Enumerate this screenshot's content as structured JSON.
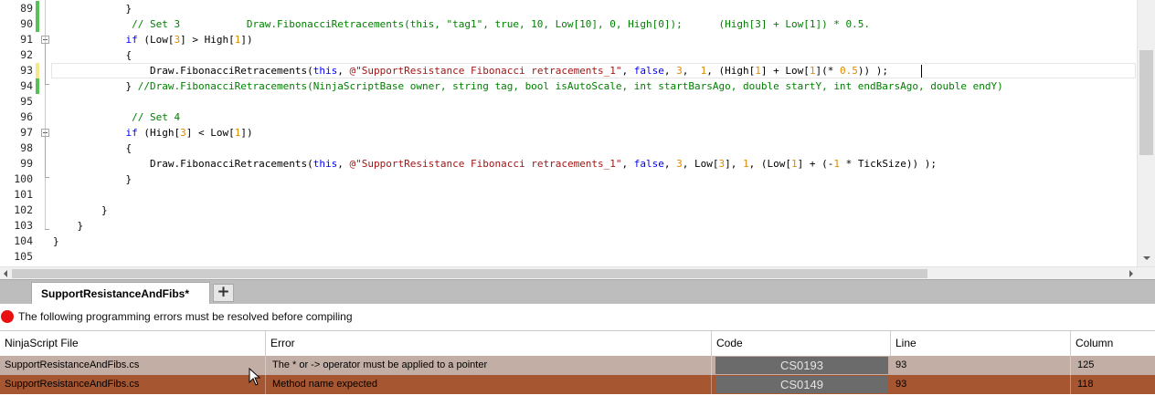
{
  "editor": {
    "lines": [
      {
        "num": "89",
        "code": "            }",
        "change": "saved",
        "fold": "none"
      },
      {
        "num": "90",
        "code": "             // Set 3           Draw.FibonacciRetracements(this, \"tag1\", true, 10, Low[10], 0, High[0]);      (High[3] + Low[1]) * 0.5.",
        "change": "saved",
        "fold": "none"
      },
      {
        "num": "91",
        "code": "            if (Low[3] > High[1])",
        "change": "none",
        "fold": "open"
      },
      {
        "num": "92",
        "code": "            {",
        "change": "none",
        "fold": "none"
      },
      {
        "num": "93",
        "code": "                Draw.FibonacciRetracements(this, @\"SupportResistance Fibonacci retracements_1\", false, 3,  1, (High[1] + Low[1](* 0.5)) );",
        "change": "unsaved",
        "fold": "none"
      },
      {
        "num": "94",
        "code": "            } //Draw.FibonacciRetracements(NinjaScriptBase owner, string tag, bool isAutoScale, int startBarsAgo, double startY, int endBarsAgo, double endY)",
        "change": "saved",
        "fold": "none"
      },
      {
        "num": "95",
        "code": "",
        "change": "none",
        "fold": "none"
      },
      {
        "num": "96",
        "code": "             // Set 4",
        "change": "none",
        "fold": "none"
      },
      {
        "num": "97",
        "code": "            if (High[3] < Low[1])",
        "change": "none",
        "fold": "open"
      },
      {
        "num": "98",
        "code": "            {",
        "change": "none",
        "fold": "none"
      },
      {
        "num": "99",
        "code": "                Draw.FibonacciRetracements(this, @\"SupportResistance Fibonacci retracements_1\", false, 3, Low[3], 1, (Low[1] + (-1 * TickSize)) );",
        "change": "none",
        "fold": "none"
      },
      {
        "num": "100",
        "code": "            }",
        "change": "none",
        "fold": "none"
      },
      {
        "num": "101",
        "code": "",
        "change": "none",
        "fold": "none"
      },
      {
        "num": "102",
        "code": "        }",
        "change": "none",
        "fold": "none"
      },
      {
        "num": "103",
        "code": "    }",
        "change": "none",
        "fold": "none"
      },
      {
        "num": "104",
        "code": "}",
        "change": "none",
        "fold": "none"
      },
      {
        "num": "105",
        "code": "",
        "change": "none",
        "fold": "none"
      }
    ],
    "current_line": "93"
  },
  "tabs": {
    "active_label": "SupportResistanceAndFibs*",
    "add_label": "+"
  },
  "errors": {
    "banner": "The following programming errors must be resolved before compiling",
    "columns": [
      "NinjaScript File",
      "Error",
      "Code",
      "Line",
      "Column"
    ],
    "rows": [
      {
        "file": "SupportResistanceAndFibs.cs",
        "error": "The * or -> operator must be applied to a pointer",
        "code": "CS0193",
        "line": "93",
        "column": "125"
      },
      {
        "file": "SupportResistanceAndFibs.cs",
        "error": "Method name expected",
        "code": "CS0149",
        "line": "93",
        "column": "118"
      }
    ]
  },
  "colors": {
    "keyword": "#0000ff",
    "comment": "#008000",
    "string": "#a31515",
    "number": "#e08a00",
    "row_selected": "#c3aea5",
    "row_error": "#a65732",
    "error_dot": "#e81010"
  },
  "icons": [
    "error-dot-icon",
    "fold-toggle-icon",
    "add-tab-icon",
    "mouse-pointer-icon"
  ]
}
